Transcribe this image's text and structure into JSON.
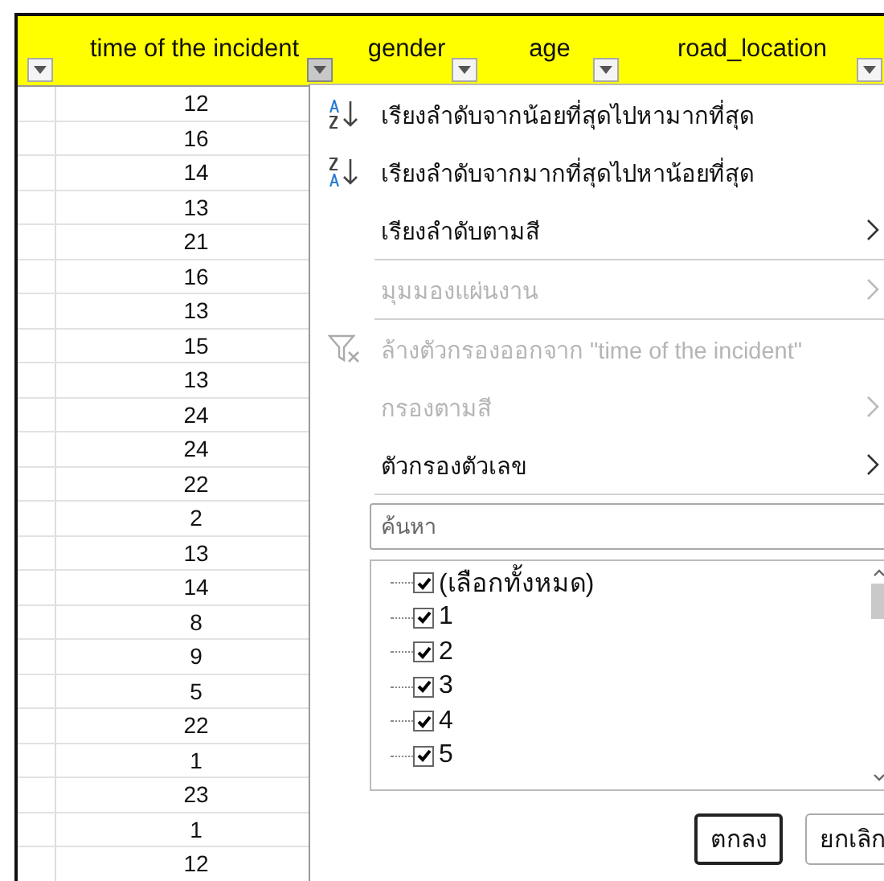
{
  "columns": [
    {
      "selected": false
    },
    {
      "label": "time of the incident",
      "selected": true
    },
    {
      "label": "gender",
      "selected": false
    },
    {
      "label": "age",
      "selected": false
    },
    {
      "label": "road_location",
      "selected": false
    }
  ],
  "rows": [
    "12",
    "16",
    "14",
    "13",
    "21",
    "16",
    "13",
    "15",
    "13",
    "24",
    "24",
    "22",
    "2",
    "13",
    "14",
    "8",
    "9",
    "5",
    "22",
    "1",
    "23",
    "1",
    "12"
  ],
  "filter_menu": {
    "items": [
      {
        "kind": "sort_ascending",
        "label": "เรียงลำดับจากน้อยที่สุดไปหามากที่สุด",
        "disabled": false,
        "separator_after": false
      },
      {
        "kind": "sort_descending",
        "label": "เรียงลำดับจากมากที่สุดไปหาน้อยที่สุด",
        "disabled": false,
        "separator_after": false
      },
      {
        "kind": "submenu",
        "label": "เรียงลำดับตามสี",
        "disabled": false,
        "separator_after": true
      },
      {
        "kind": "submenu",
        "label": "มุมมองแผ่นงาน",
        "disabled": true,
        "separator_after": true
      },
      {
        "kind": "clear_filter",
        "label": "ล้างตัวกรองออกจาก \"time of the incident\"",
        "disabled": true,
        "separator_after": false
      },
      {
        "kind": "submenu",
        "label": "กรองตามสี",
        "disabled": true,
        "separator_after": false
      },
      {
        "kind": "submenu",
        "label": "ตัวกรองตัวเลข",
        "disabled": false,
        "separator_after": true
      }
    ],
    "search": {
      "placeholder": "ค้นหา"
    },
    "values": [
      {
        "label": "(เลือกทั้งหมด)",
        "checked": true
      },
      {
        "label": "1",
        "checked": true
      },
      {
        "label": "2",
        "checked": true
      },
      {
        "label": "3",
        "checked": true
      },
      {
        "label": "4",
        "checked": true
      },
      {
        "label": "5",
        "checked": true
      }
    ],
    "buttons": [
      {
        "label": "ตกลง",
        "default": true
      },
      {
        "label": "ยกเลิก",
        "default": false
      }
    ]
  }
}
